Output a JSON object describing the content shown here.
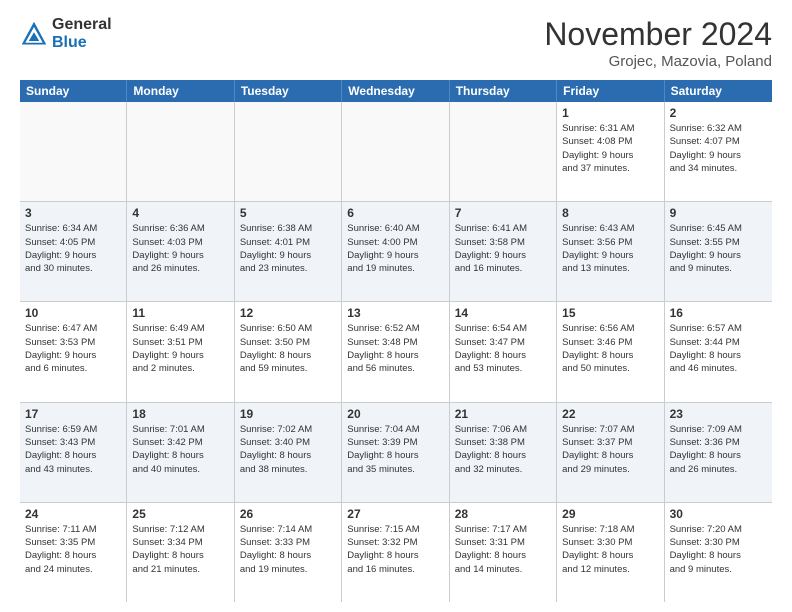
{
  "header": {
    "logo_general": "General",
    "logo_blue": "Blue",
    "month_title": "November 2024",
    "location": "Grojec, Mazovia, Poland"
  },
  "days_of_week": [
    "Sunday",
    "Monday",
    "Tuesday",
    "Wednesday",
    "Thursday",
    "Friday",
    "Saturday"
  ],
  "weeks": [
    [
      {
        "day": "",
        "info": "",
        "empty": true
      },
      {
        "day": "",
        "info": "",
        "empty": true
      },
      {
        "day": "",
        "info": "",
        "empty": true
      },
      {
        "day": "",
        "info": "",
        "empty": true
      },
      {
        "day": "",
        "info": "",
        "empty": true
      },
      {
        "day": "1",
        "info": "Sunrise: 6:31 AM\nSunset: 4:08 PM\nDaylight: 9 hours\nand 37 minutes."
      },
      {
        "day": "2",
        "info": "Sunrise: 6:32 AM\nSunset: 4:07 PM\nDaylight: 9 hours\nand 34 minutes."
      }
    ],
    [
      {
        "day": "3",
        "info": "Sunrise: 6:34 AM\nSunset: 4:05 PM\nDaylight: 9 hours\nand 30 minutes."
      },
      {
        "day": "4",
        "info": "Sunrise: 6:36 AM\nSunset: 4:03 PM\nDaylight: 9 hours\nand 26 minutes."
      },
      {
        "day": "5",
        "info": "Sunrise: 6:38 AM\nSunset: 4:01 PM\nDaylight: 9 hours\nand 23 minutes."
      },
      {
        "day": "6",
        "info": "Sunrise: 6:40 AM\nSunset: 4:00 PM\nDaylight: 9 hours\nand 19 minutes."
      },
      {
        "day": "7",
        "info": "Sunrise: 6:41 AM\nSunset: 3:58 PM\nDaylight: 9 hours\nand 16 minutes."
      },
      {
        "day": "8",
        "info": "Sunrise: 6:43 AM\nSunset: 3:56 PM\nDaylight: 9 hours\nand 13 minutes."
      },
      {
        "day": "9",
        "info": "Sunrise: 6:45 AM\nSunset: 3:55 PM\nDaylight: 9 hours\nand 9 minutes."
      }
    ],
    [
      {
        "day": "10",
        "info": "Sunrise: 6:47 AM\nSunset: 3:53 PM\nDaylight: 9 hours\nand 6 minutes."
      },
      {
        "day": "11",
        "info": "Sunrise: 6:49 AM\nSunset: 3:51 PM\nDaylight: 9 hours\nand 2 minutes."
      },
      {
        "day": "12",
        "info": "Sunrise: 6:50 AM\nSunset: 3:50 PM\nDaylight: 8 hours\nand 59 minutes."
      },
      {
        "day": "13",
        "info": "Sunrise: 6:52 AM\nSunset: 3:48 PM\nDaylight: 8 hours\nand 56 minutes."
      },
      {
        "day": "14",
        "info": "Sunrise: 6:54 AM\nSunset: 3:47 PM\nDaylight: 8 hours\nand 53 minutes."
      },
      {
        "day": "15",
        "info": "Sunrise: 6:56 AM\nSunset: 3:46 PM\nDaylight: 8 hours\nand 50 minutes."
      },
      {
        "day": "16",
        "info": "Sunrise: 6:57 AM\nSunset: 3:44 PM\nDaylight: 8 hours\nand 46 minutes."
      }
    ],
    [
      {
        "day": "17",
        "info": "Sunrise: 6:59 AM\nSunset: 3:43 PM\nDaylight: 8 hours\nand 43 minutes."
      },
      {
        "day": "18",
        "info": "Sunrise: 7:01 AM\nSunset: 3:42 PM\nDaylight: 8 hours\nand 40 minutes."
      },
      {
        "day": "19",
        "info": "Sunrise: 7:02 AM\nSunset: 3:40 PM\nDaylight: 8 hours\nand 38 minutes."
      },
      {
        "day": "20",
        "info": "Sunrise: 7:04 AM\nSunset: 3:39 PM\nDaylight: 8 hours\nand 35 minutes."
      },
      {
        "day": "21",
        "info": "Sunrise: 7:06 AM\nSunset: 3:38 PM\nDaylight: 8 hours\nand 32 minutes."
      },
      {
        "day": "22",
        "info": "Sunrise: 7:07 AM\nSunset: 3:37 PM\nDaylight: 8 hours\nand 29 minutes."
      },
      {
        "day": "23",
        "info": "Sunrise: 7:09 AM\nSunset: 3:36 PM\nDaylight: 8 hours\nand 26 minutes."
      }
    ],
    [
      {
        "day": "24",
        "info": "Sunrise: 7:11 AM\nSunset: 3:35 PM\nDaylight: 8 hours\nand 24 minutes."
      },
      {
        "day": "25",
        "info": "Sunrise: 7:12 AM\nSunset: 3:34 PM\nDaylight: 8 hours\nand 21 minutes."
      },
      {
        "day": "26",
        "info": "Sunrise: 7:14 AM\nSunset: 3:33 PM\nDaylight: 8 hours\nand 19 minutes."
      },
      {
        "day": "27",
        "info": "Sunrise: 7:15 AM\nSunset: 3:32 PM\nDaylight: 8 hours\nand 16 minutes."
      },
      {
        "day": "28",
        "info": "Sunrise: 7:17 AM\nSunset: 3:31 PM\nDaylight: 8 hours\nand 14 minutes."
      },
      {
        "day": "29",
        "info": "Sunrise: 7:18 AM\nSunset: 3:30 PM\nDaylight: 8 hours\nand 12 minutes."
      },
      {
        "day": "30",
        "info": "Sunrise: 7:20 AM\nSunset: 3:30 PM\nDaylight: 8 hours\nand 9 minutes."
      }
    ]
  ]
}
